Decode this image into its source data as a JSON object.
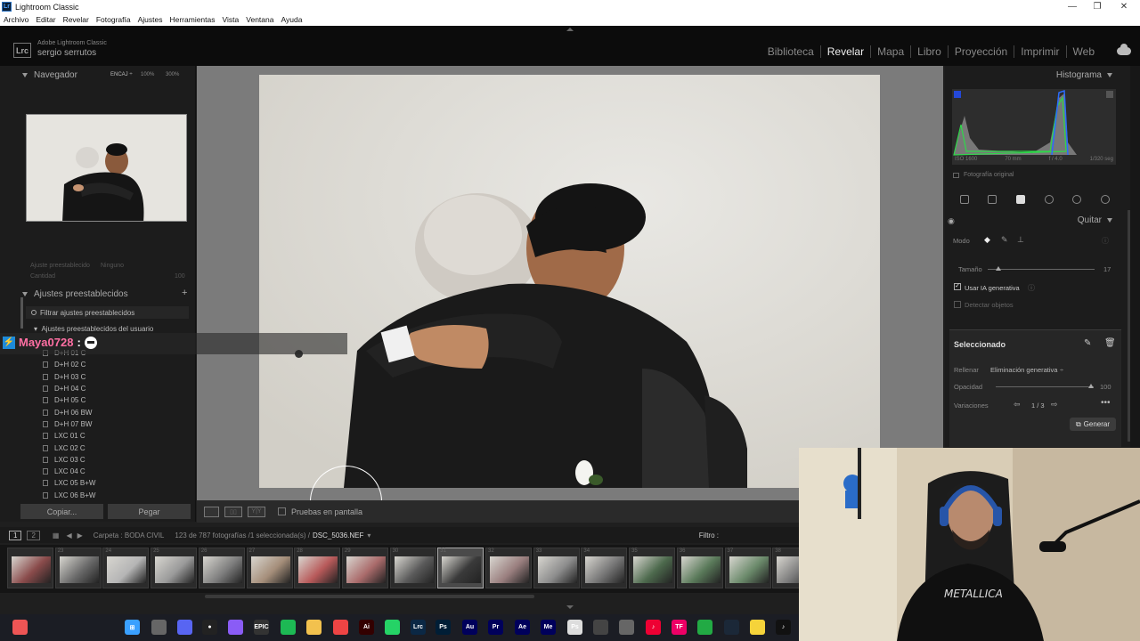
{
  "window": {
    "title": "Lightroom Classic",
    "icon_label": "Lr"
  },
  "menu": [
    "Archivo",
    "Editar",
    "Revelar",
    "Fotografía",
    "Ajustes",
    "Herramientas",
    "Vista",
    "Ventana",
    "Ayuda"
  ],
  "header": {
    "brand": "Adobe Lightroom Classic",
    "user": "sergio serrutos",
    "logo": "Lrc",
    "modules": [
      "Biblioteca",
      "Revelar",
      "Mapa",
      "Libro",
      "Proyección",
      "Imprimir",
      "Web"
    ],
    "active_module": "Revelar"
  },
  "left": {
    "navigator_title": "Navegador",
    "zoom_options": [
      "ENCAJ ÷",
      "100%",
      "300%"
    ],
    "preset_setting_label": "Ajuste preestablecido",
    "preset_setting_value": "Ninguno",
    "amount_label": "Cantidad",
    "amount_value": "100",
    "presets_title": "Ajustes preestablecidos",
    "filter_placeholder": "Filtrar ajustes preestablecidos",
    "user_group": "Ajustes preestablecidos del usuario",
    "presets": [
      "D+H 01 C",
      "D+H 02 C",
      "D+H 03 C",
      "D+H 04 C",
      "D+H 05 C",
      "D+H 06 BW",
      "D+H 07 BW",
      "LXC 01 C",
      "LXC 02 C",
      "LXC 03 C",
      "LXC 04 C",
      "LXC 05 B+W",
      "LXC 06 B+W"
    ],
    "copy_label": "Copiar...",
    "paste_label": "Pegar"
  },
  "overlay": {
    "username": "Maya0728",
    "colon": ":"
  },
  "toolbar": {
    "proof_label": "Pruebas en pantalla",
    "ref_view_label": "Y|Y"
  },
  "right": {
    "histogram_title": "Histograma",
    "exif": [
      "ISO 1600",
      "70 mm",
      "f / 4.0",
      "1/320 seg"
    ],
    "original_label": "Fotografía original",
    "remove_title": "Quitar",
    "mode_label": "Modo",
    "size_label": "Tamaño",
    "size_value": "17",
    "size_fraction": 0.1,
    "use_ai_label": "Usar IA generativa",
    "use_ai_checked": true,
    "detect_label": "Detectar objetos",
    "selected_title": "Seleccionado",
    "fill_label": "Rellenar",
    "fill_value": "Eliminación generativa",
    "opacity_label": "Opacidad",
    "opacity_value": "100",
    "variations_label": "Variaciones",
    "variations_value": "1 / 3",
    "generate_label": "Generar"
  },
  "filmstrip": {
    "view_nums": [
      "1",
      "2"
    ],
    "source": "Carpeta : BODA CIVIL",
    "count": "123 de 787 fotografías /1 seleccionada(s) /",
    "filename": "DSC_5036.NEF",
    "filter_label": "Filtro :",
    "thumb_numbers": [
      "",
      "23",
      "24",
      "25",
      "26",
      "27",
      "28",
      "29",
      "30",
      "31",
      "32",
      "33",
      "34",
      "35",
      "36",
      "37",
      "38"
    ],
    "selected_index": 9
  },
  "colors": {
    "accent": "#4da3ff",
    "username": "#ff6fa3",
    "panel": "#1c1c1c"
  }
}
